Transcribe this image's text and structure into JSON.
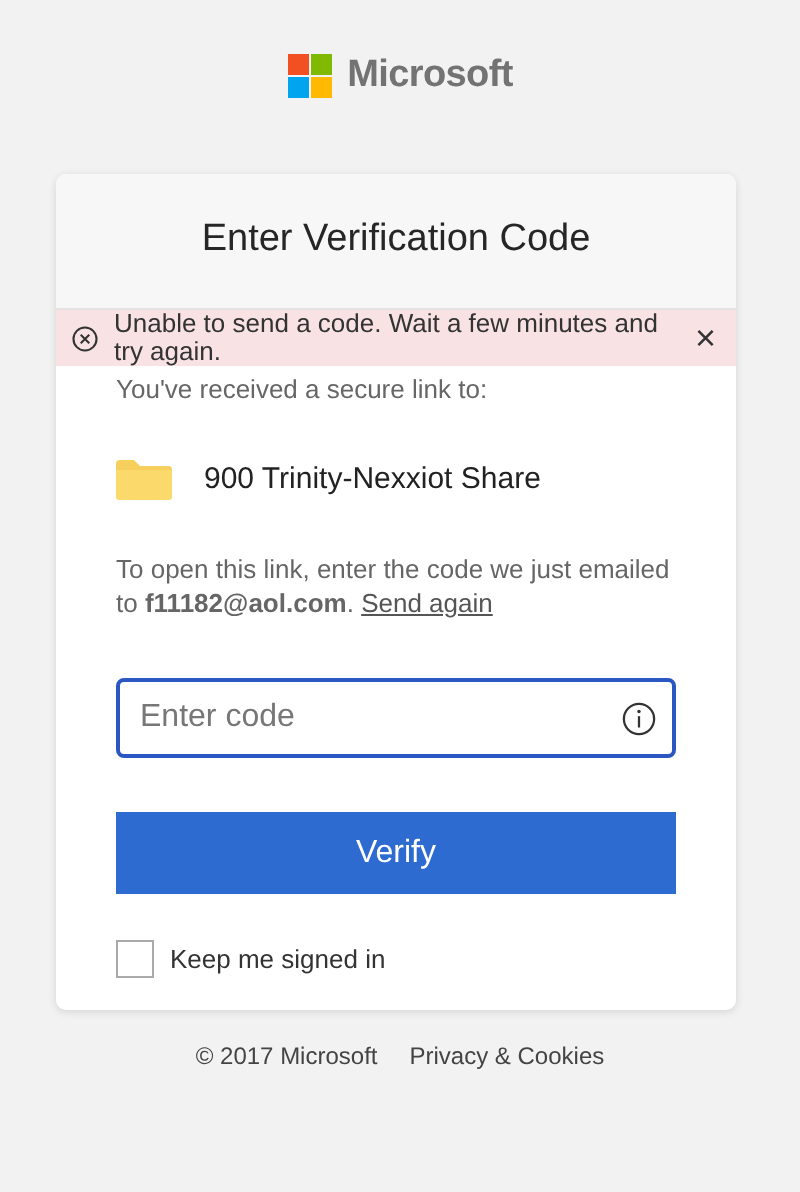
{
  "brand": {
    "name": "Microsoft"
  },
  "card": {
    "title": "Enter Verification Code",
    "error": {
      "message": "Unable to send a code. Wait a few minutes and try again.",
      "close": "×"
    },
    "intro": "You've received a secure link to:",
    "item": {
      "name": "900 Trinity-Nexxiot Share"
    },
    "instructions": "To open this link, enter the code we just emailed to **f11182@aol.com**.",
    "resend_link": "Send again",
    "code_field": {
      "placeholder": "Enter code"
    },
    "verify_button": "Verify",
    "keep_signed_in": {
      "label": "Keep me signed in",
      "checked": false
    }
  },
  "footer": {
    "copyright": "© 2017 Microsoft",
    "privacy_link": "Privacy & Cookies"
  }
}
